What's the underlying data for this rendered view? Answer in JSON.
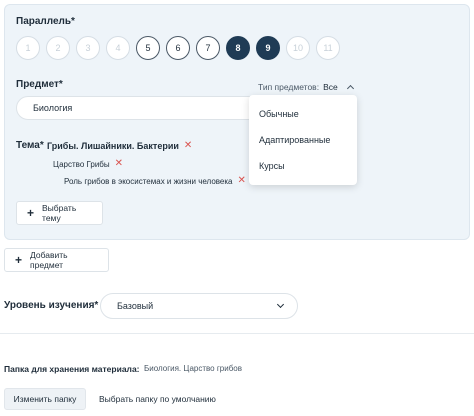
{
  "parallel": {
    "label": "Параллель*",
    "grades": [
      {
        "n": "1",
        "state": "disabled"
      },
      {
        "n": "2",
        "state": "disabled"
      },
      {
        "n": "3",
        "state": "disabled"
      },
      {
        "n": "4",
        "state": "disabled"
      },
      {
        "n": "5",
        "state": "available"
      },
      {
        "n": "6",
        "state": "available"
      },
      {
        "n": "7",
        "state": "available"
      },
      {
        "n": "8",
        "state": "selected"
      },
      {
        "n": "9",
        "state": "selected"
      },
      {
        "n": "10",
        "state": "disabled"
      },
      {
        "n": "11",
        "state": "disabled"
      }
    ]
  },
  "subject": {
    "label": "Предмет*",
    "value": "Биология",
    "type_filter_label": "Тип предметов:",
    "type_filter_value": "Все",
    "type_options": [
      "Обычные",
      "Адаптированные",
      "Курсы"
    ]
  },
  "topic": {
    "label": "Тема*",
    "items": [
      {
        "text": "Грибы. Лишайники. Бактерии",
        "level": 0
      },
      {
        "text": "Царство Грибы",
        "level": 1
      },
      {
        "text": "Роль грибов в экосистемах и жизни человека",
        "level": 2
      }
    ],
    "remove_glyph": "✕",
    "add_button": "Выбрать тему"
  },
  "add_subject_button": "Добавить предмет",
  "study_level": {
    "label": "Уровень изучения*",
    "value": "Базовый"
  },
  "folder": {
    "label": "Папка для хранения материала:",
    "value": "Биология. Царство грибов",
    "change_button": "Изменить папку",
    "default_link": "Выбрать папку по умолчанию"
  },
  "icons": {
    "plus": "+",
    "close": "✕",
    "chevron_up": "chevron-up-icon",
    "chevron_down": "chevron-down-icon"
  },
  "colors": {
    "accent": "#1f3b55",
    "remove": "#d9534f",
    "panel_bg": "#eef4f9"
  }
}
